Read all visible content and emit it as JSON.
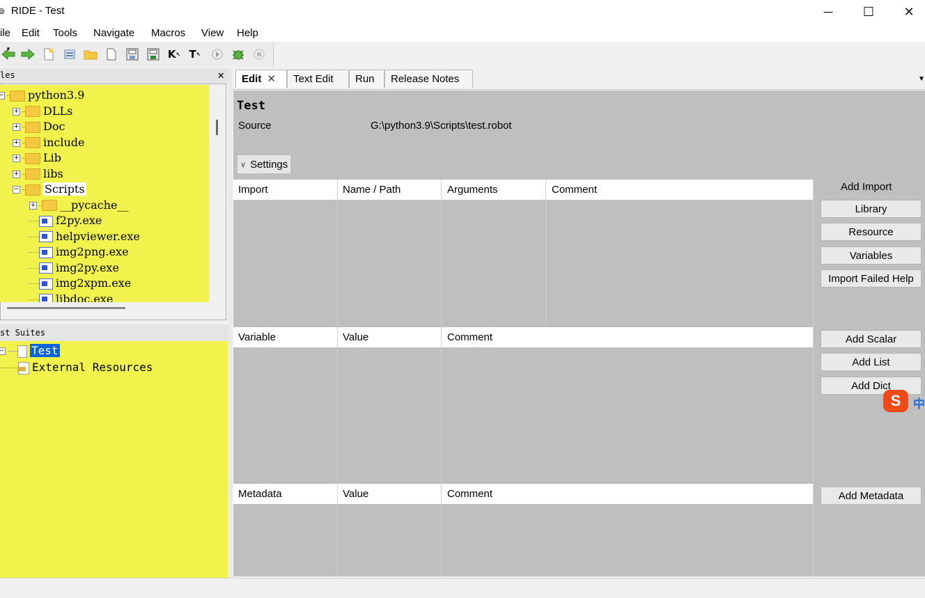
{
  "window": {
    "title": "RIDE - Test",
    "icon": "ride-app-icon",
    "minimize": "─",
    "maximize": "☐",
    "close": "✕"
  },
  "menu": [
    "ile",
    "Edit",
    "Tools",
    "Navigate",
    "Macros",
    "View",
    "Help"
  ],
  "toolbar": {
    "icons": [
      "go-back-icon",
      "go-forward-icon",
      "new-project-icon",
      "open-test-suite-icon",
      "open-directory-icon",
      "new-file-icon",
      "save-icon",
      "save-all-icon",
      "search-keywords-icon",
      "search-tests-icon",
      "run-icon",
      "debug-icon",
      "stop-icon"
    ],
    "keyword_glyph": "K",
    "test_glyph": "T"
  },
  "files_panel": {
    "title": "les",
    "close": "✕",
    "tree": [
      {
        "label": "python3.9",
        "type": "folder",
        "expander": "⊟",
        "depth": 0
      },
      {
        "label": "DLLs",
        "type": "folder",
        "expander": "⊞",
        "depth": 1
      },
      {
        "label": "Doc",
        "type": "folder",
        "expander": "⊞",
        "depth": 1
      },
      {
        "label": "include",
        "type": "folder",
        "expander": "⊞",
        "depth": 1
      },
      {
        "label": "Lib",
        "type": "folder",
        "expander": "⊞",
        "depth": 1
      },
      {
        "label": "libs",
        "type": "folder",
        "expander": "⊞",
        "depth": 1
      },
      {
        "label": "Scripts",
        "type": "folder",
        "expander": "⊟",
        "depth": 1
      },
      {
        "label": "__pycache__",
        "type": "folder",
        "expander": "⊞",
        "depth": 2
      },
      {
        "label": "f2py.exe",
        "type": "exe",
        "depth": 2
      },
      {
        "label": "helpviewer.exe",
        "type": "exe",
        "depth": 2
      },
      {
        "label": "img2png.exe",
        "type": "exe",
        "depth": 2
      },
      {
        "label": "img2py.exe",
        "type": "exe",
        "depth": 2
      },
      {
        "label": "img2xpm.exe",
        "type": "exe",
        "depth": 2
      },
      {
        "label": "libdoc.exe",
        "type": "exe",
        "depth": 2
      }
    ]
  },
  "suites_panel": {
    "title": "st Suites",
    "tree": [
      {
        "label": "Test",
        "selected": true
      },
      {
        "label": "External Resources",
        "selected": false
      }
    ]
  },
  "tabs": [
    "Edit",
    "Text Edit",
    "Run",
    "Release Notes"
  ],
  "tab_close": "✕",
  "editor": {
    "suite_name": "Test",
    "source_label": "Source",
    "source_value": "G:\\python3.9\\Scripts\\test.robot",
    "settings_label": "Settings",
    "import_table": {
      "columns": [
        "Import",
        "Name / Path",
        "Arguments",
        "Comment"
      ],
      "side_label": "Add Import",
      "buttons": [
        "Library",
        "Resource",
        "Variables",
        "Import Failed Help"
      ]
    },
    "variable_table": {
      "columns": [
        "Variable",
        "Value",
        "Comment"
      ],
      "buttons": [
        "Add Scalar",
        "Add List",
        "Add Dict"
      ]
    },
    "metadata_table": {
      "columns": [
        "Metadata",
        "Value",
        "Comment"
      ],
      "buttons": [
        "Add Metadata"
      ]
    }
  },
  "ime": {
    "logo": "S",
    "text": "中"
  }
}
